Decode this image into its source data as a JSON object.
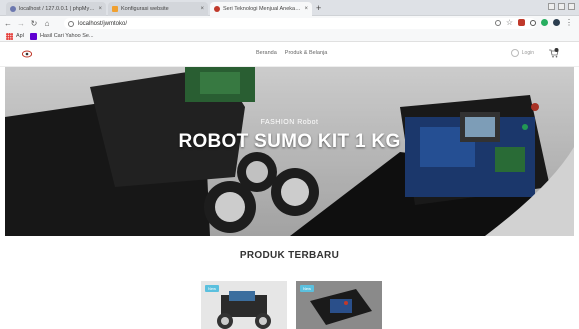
{
  "browser": {
    "tabs": [
      {
        "title": "localhost / 127.0.0.1 | phpMyAd",
        "icon": "phpmyadmin-icon",
        "active": false
      },
      {
        "title": "Konfigurasi website",
        "icon": "config-icon",
        "active": false
      },
      {
        "title": "Seri Teknologi Menjual Aneka Ro",
        "icon": "site-icon",
        "active": true
      }
    ],
    "address": "localhost/jwmtoko/",
    "bookmarks": [
      {
        "label": "Apl",
        "icon": "apps-icon"
      },
      {
        "label": "Hasil Cari Yahoo Se...",
        "icon": "yahoo-icon"
      }
    ]
  },
  "site": {
    "nav": [
      "Beranda",
      "Produk & Belanja"
    ],
    "login": "Login"
  },
  "hero": {
    "subtitle": "FASHION Robot",
    "title": "ROBOT SUMO KIT 1 KG"
  },
  "products": {
    "title": "PRODUK TERBARU",
    "items": [
      {
        "badge": "New"
      },
      {
        "badge": "New"
      }
    ]
  },
  "colors": {
    "accent": "#5bc0de",
    "yahoo": "#6001d2"
  }
}
